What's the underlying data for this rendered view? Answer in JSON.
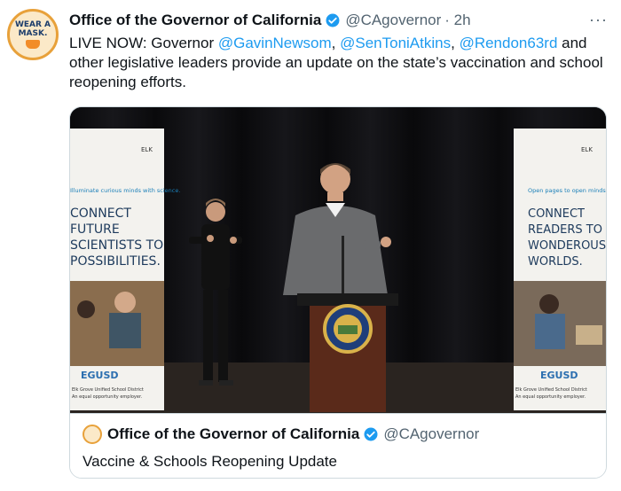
{
  "author": {
    "name": "Office of the Governor of California",
    "handle": "@CAgovernor",
    "time": "· 2h",
    "avatar_text_line1": "WEAR A",
    "avatar_text_line2": "MASK."
  },
  "tweet": {
    "text_part1": "LIVE NOW: Governor ",
    "mention1": "@GavinNewsom",
    "sep1": ", ",
    "mention2": "@SenToniAtkins",
    "sep2": ", ",
    "mention3": "@Rendon63rd",
    "text_part2": " and other legislative leaders provide an update on the state’s vaccination and school reopening efforts."
  },
  "more_label": "···",
  "video": {
    "banner_left_tagline": "Illuminate curious minds with science.",
    "banner_left_headline": [
      "CONNECT",
      "FUTURE",
      "SCIENTISTS TO",
      "POSSIBILITIES."
    ],
    "banner_right_tagline": "Open pages to open minds.",
    "banner_right_headline": [
      "CONNECT",
      "READERS TO",
      "WONDEROUS",
      "WORLDS."
    ],
    "banner_brand": "EGUSD",
    "banner_footer": "Elk Grove Unified School District",
    "banner_footer2": "An equal opportunity employer."
  },
  "card": {
    "name": "Office of the Governor of California",
    "handle": "@CAgovernor",
    "title": "Vaccine & Schools Reopening Update"
  },
  "colors": {
    "link": "#1d9bf0",
    "verified": "#1d9bf0",
    "muted": "#536471"
  }
}
